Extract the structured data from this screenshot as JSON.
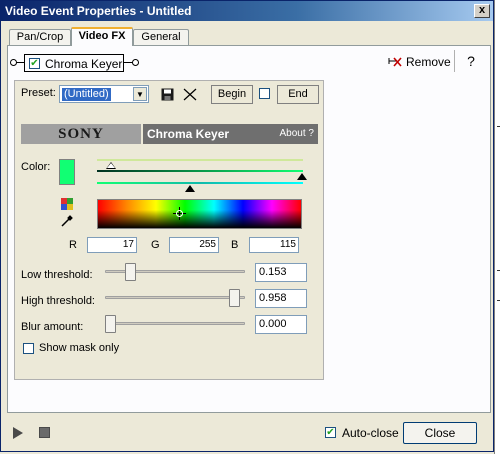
{
  "window": {
    "title": "Video Event Properties - Untitled",
    "close_glyph": "x"
  },
  "tabs": [
    {
      "label": "Pan/Crop",
      "active": false
    },
    {
      "label": "Video FX",
      "active": true
    },
    {
      "label": "General",
      "active": false
    }
  ],
  "plugin": {
    "name": "Chroma Keyer",
    "enabled": true,
    "remove_label": "Remove",
    "help_glyph": "?"
  },
  "preset": {
    "label": "Preset:",
    "value": "(Untitled)",
    "begin_label": "Begin",
    "end_label": "End"
  },
  "banner": {
    "brand": "SONY",
    "plugin_name": "Chroma Keyer",
    "about": "About  ?"
  },
  "color": {
    "label": "Color:",
    "swatch": "#11ff73",
    "r_label": "R",
    "g_label": "G",
    "b_label": "B",
    "r": "17",
    "g": "255",
    "b": "115"
  },
  "params": {
    "low_threshold": {
      "label": "Low threshold:",
      "value": "0.153",
      "level": 0.153
    },
    "high_threshold": {
      "label": "High threshold:",
      "value": "0.958",
      "level": 0.958
    },
    "blur_amount": {
      "label": "Blur amount:",
      "value": "0.000",
      "level": 0.0
    }
  },
  "show_mask": {
    "label": "Show mask only",
    "checked": false
  },
  "footer": {
    "auto_close_label": "Auto-close",
    "auto_close_checked": true,
    "close_label": "Close"
  }
}
